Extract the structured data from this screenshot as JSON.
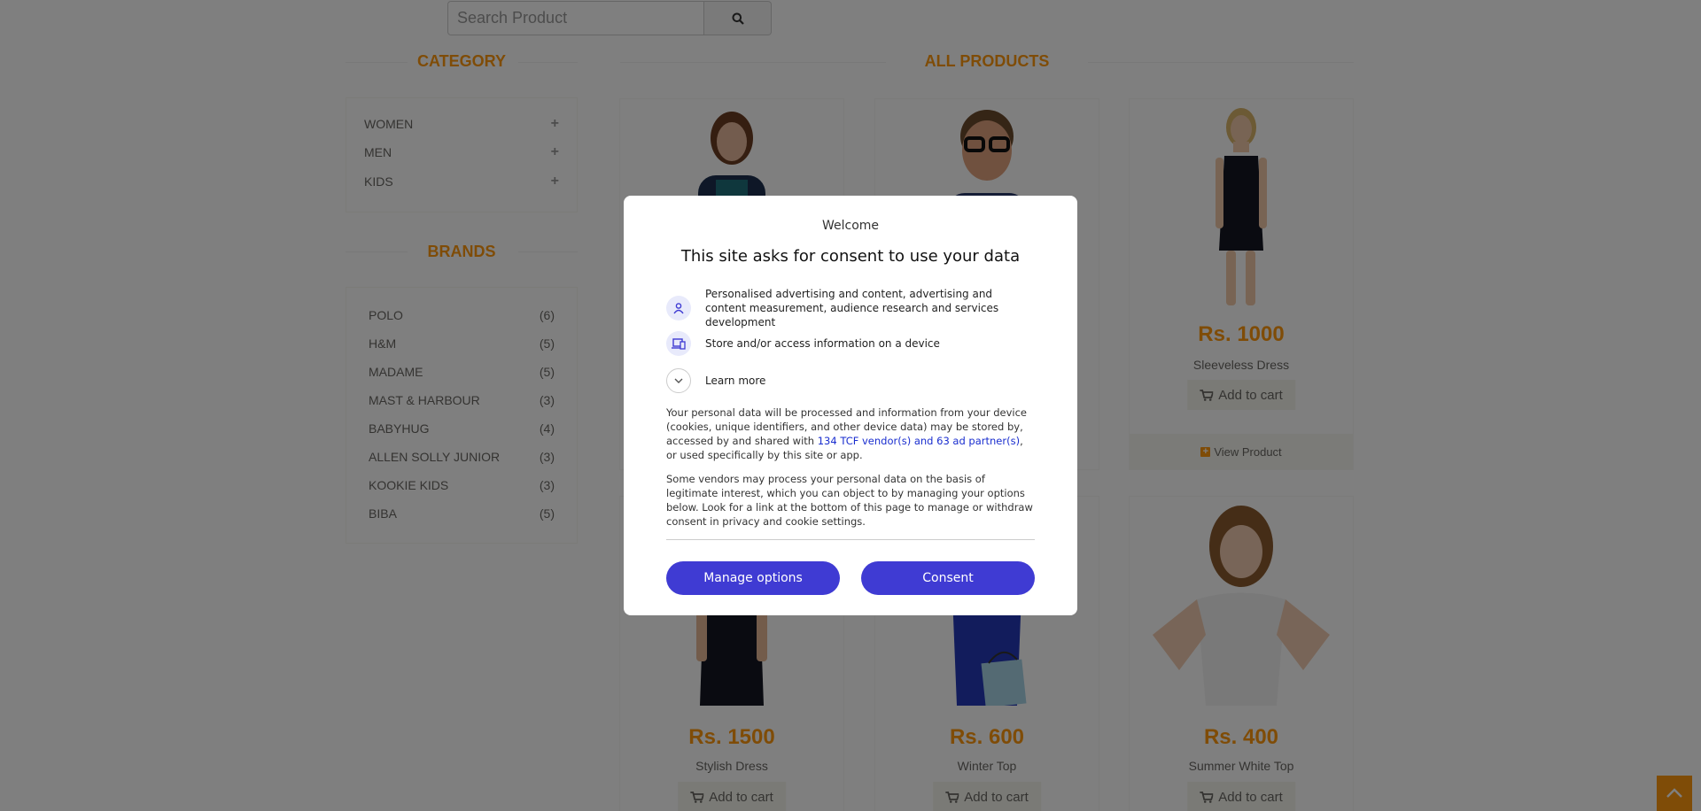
{
  "search": {
    "placeholder": "Search Product"
  },
  "sidebar": {
    "category_title": "CATEGORY",
    "categories": [
      {
        "label": "WOMEN"
      },
      {
        "label": "MEN"
      },
      {
        "label": "KIDS"
      }
    ],
    "brands_title": "BRANDS",
    "brands": [
      {
        "label": "POLO",
        "count": "(6)"
      },
      {
        "label": "H&M",
        "count": "(5)"
      },
      {
        "label": "MADAME",
        "count": "(5)"
      },
      {
        "label": "MAST & HARBOUR",
        "count": "(3)"
      },
      {
        "label": "BABYHUG",
        "count": "(4)"
      },
      {
        "label": "ALLEN SOLLY JUNIOR",
        "count": "(3)"
      },
      {
        "label": "KOOKIE KIDS",
        "count": "(3)"
      },
      {
        "label": "BIBA",
        "count": "(5)"
      }
    ]
  },
  "products": {
    "title": "ALL PRODUCTS",
    "items": [
      {
        "price": "Rs. 1000",
        "name": "Sleeveless Dress",
        "cart": "Add to cart",
        "view": "View Product"
      },
      {
        "price": "Rs. 1500",
        "name": "Stylish Dress",
        "cart": "Add to cart"
      },
      {
        "price": "Rs. 600",
        "name": "Winter Top",
        "cart": "Add to cart"
      },
      {
        "price": "Rs. 400",
        "name": "Summer White Top",
        "cart": "Add to cart"
      }
    ]
  },
  "consent": {
    "welcome": "Welcome",
    "heading": "This site asks for consent to use your data",
    "purpose1": "Personalised advertising and content, advertising and content measurement, audience research and services development",
    "purpose2": "Store and/or access information on a device",
    "learn_more": "Learn more",
    "para1_before": "Your personal data will be processed and information from your device (cookies, unique identifiers, and other device data) may be stored by, accessed by and shared with ",
    "para1_link": "134 TCF vendor(s) and 63 ad partner(s)",
    "para1_after": ", or used specifically by this site or app.",
    "para2": "Some vendors may process your personal data on the basis of legitimate interest, which you can object to by managing your options below. Look for a link at the bottom of this page to manage or withdraw consent in privacy and cookie settings.",
    "manage_label": "Manage options",
    "consent_label": "Consent"
  },
  "colors": {
    "accent": "#fe980f",
    "consent_button": "#3f3bd3",
    "link": "#1a2ecf"
  }
}
